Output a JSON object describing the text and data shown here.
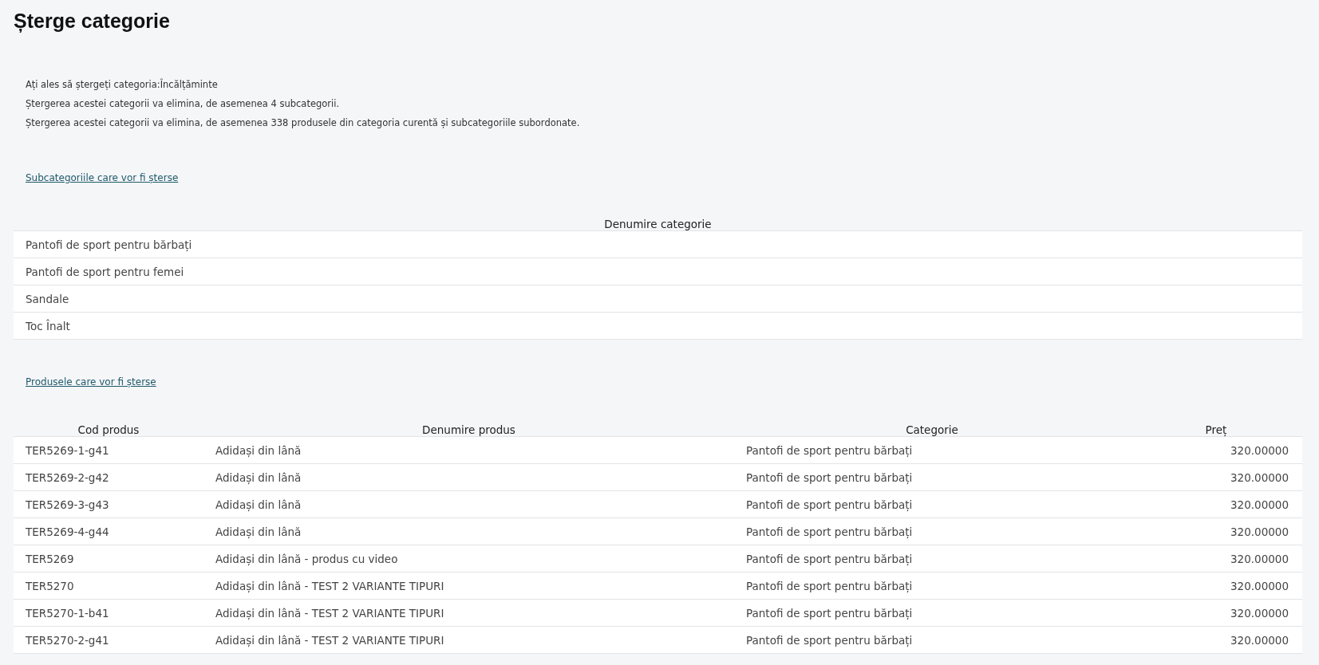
{
  "title": "Șterge categorie",
  "info_lines": [
    "Ați ales să ștergeți categoria:Încălțăminte",
    "Ștergerea acestei categorii va elimina, de asemenea 4 subcategorii.",
    "Ștergerea acestei categorii va elimina, de asemenea 338 produsele din categoria curentă și subcategoriile subordonate."
  ],
  "subcategories_link": "Subcategoriile care vor fi șterse",
  "subcategories_table": {
    "columns": [
      "Denumire categorie"
    ],
    "rows": [
      [
        "Pantofi de sport pentru bărbați"
      ],
      [
        "Pantofi de sport pentru femei"
      ],
      [
        "Sandale"
      ],
      [
        "Toc Înalt"
      ]
    ]
  },
  "products_link": "Produsele care vor fi șterse",
  "products_table": {
    "columns": [
      "Cod produs",
      "Denumire produs",
      "Categorie",
      "Preț"
    ],
    "rows": [
      [
        "TER5269-1-g41",
        "Adidași din lână",
        "Pantofi de sport pentru bărbați",
        "320.00000"
      ],
      [
        "TER5269-2-g42",
        "Adidași din lână",
        "Pantofi de sport pentru bărbați",
        "320.00000"
      ],
      [
        "TER5269-3-g43",
        "Adidași din lână",
        "Pantofi de sport pentru bărbați",
        "320.00000"
      ],
      [
        "TER5269-4-g44",
        "Adidași din lână",
        "Pantofi de sport pentru bărbați",
        "320.00000"
      ],
      [
        "TER5269",
        "Adidași din lână - produs cu video",
        "Pantofi de sport pentru bărbați",
        "320.00000"
      ],
      [
        "TER5270",
        "Adidași din lână - TEST 2 VARIANTE TIPURI",
        "Pantofi de sport pentru bărbați",
        "320.00000"
      ],
      [
        "TER5270-1-b41",
        "Adidași din lână - TEST 2 VARIANTE TIPURI",
        "Pantofi de sport pentru bărbați",
        "320.00000"
      ],
      [
        "TER5270-2-g41",
        "Adidași din lână - TEST 2 VARIANTE TIPURI",
        "Pantofi de sport pentru bărbați",
        "320.00000"
      ]
    ]
  }
}
